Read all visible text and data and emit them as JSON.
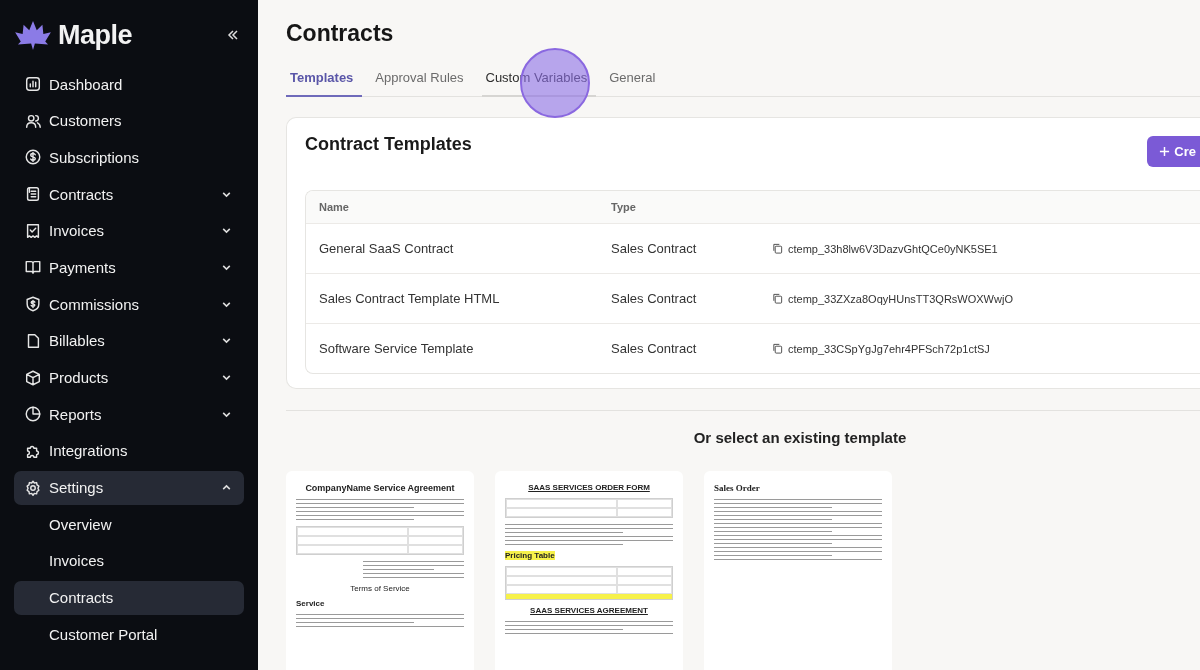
{
  "brand": {
    "name": "Maple"
  },
  "sidebar": {
    "items": [
      {
        "label": "Dashboard",
        "selected": false
      },
      {
        "label": "Customers",
        "selected": false
      },
      {
        "label": "Subscriptions",
        "selected": false
      },
      {
        "label": "Contracts",
        "expanded": false,
        "selected": false
      },
      {
        "label": "Invoices",
        "expanded": false,
        "selected": false
      },
      {
        "label": "Payments",
        "expanded": false,
        "selected": false
      },
      {
        "label": "Commissions",
        "expanded": false,
        "selected": false
      },
      {
        "label": "Billables",
        "expanded": false,
        "selected": false
      },
      {
        "label": "Products",
        "expanded": false,
        "selected": false
      },
      {
        "label": "Reports",
        "expanded": false,
        "selected": false
      },
      {
        "label": "Integrations",
        "selected": false
      },
      {
        "label": "Settings",
        "expanded": true,
        "selected": true,
        "children": [
          {
            "label": "Overview",
            "selected": false
          },
          {
            "label": "Invoices",
            "selected": false
          },
          {
            "label": "Contracts",
            "selected": true
          },
          {
            "label": "Customer Portal",
            "selected": false
          }
        ]
      }
    ]
  },
  "page": {
    "title": "Contracts"
  },
  "tabs": [
    {
      "label": "Templates",
      "selected": true
    },
    {
      "label": "Approval Rules",
      "selected": false
    },
    {
      "label": "Custom Variables",
      "selected": false,
      "hovered": true
    },
    {
      "label": "General",
      "selected": false
    }
  ],
  "card": {
    "title": "Contract Templates",
    "button": "Cre",
    "table": {
      "columns": [
        "Name",
        "Type"
      ],
      "rows": [
        {
          "name": "General SaaS Contract",
          "type": "Sales Contract",
          "id": "ctemp_33h8lw6V3DazvGhtQCe0yNK5SE1"
        },
        {
          "name": "Sales Contract Template HTML",
          "type": "Sales Contract",
          "id": "ctemp_33ZXza8OqyHUnsTT3QRsWOXWwjO"
        },
        {
          "name": "Software Service Template",
          "type": "Sales Contract",
          "id": "ctemp_33CSpYgJg7ehr4PFSch72p1ctSJ"
        }
      ]
    }
  },
  "gallery": {
    "heading": "Or select an existing template",
    "templates": [
      {
        "kind": "agreement",
        "title": "CompanyName Service Agreement",
        "section": "Terms of Service",
        "subsection": "Service"
      },
      {
        "kind": "order_form",
        "title": "SAAS SERVICES ORDER FORM",
        "section": "SAAS SERVICES AGREEMENT",
        "highlight": "Pricing Table"
      },
      {
        "kind": "sales_order",
        "title": "Sales Order"
      }
    ]
  }
}
